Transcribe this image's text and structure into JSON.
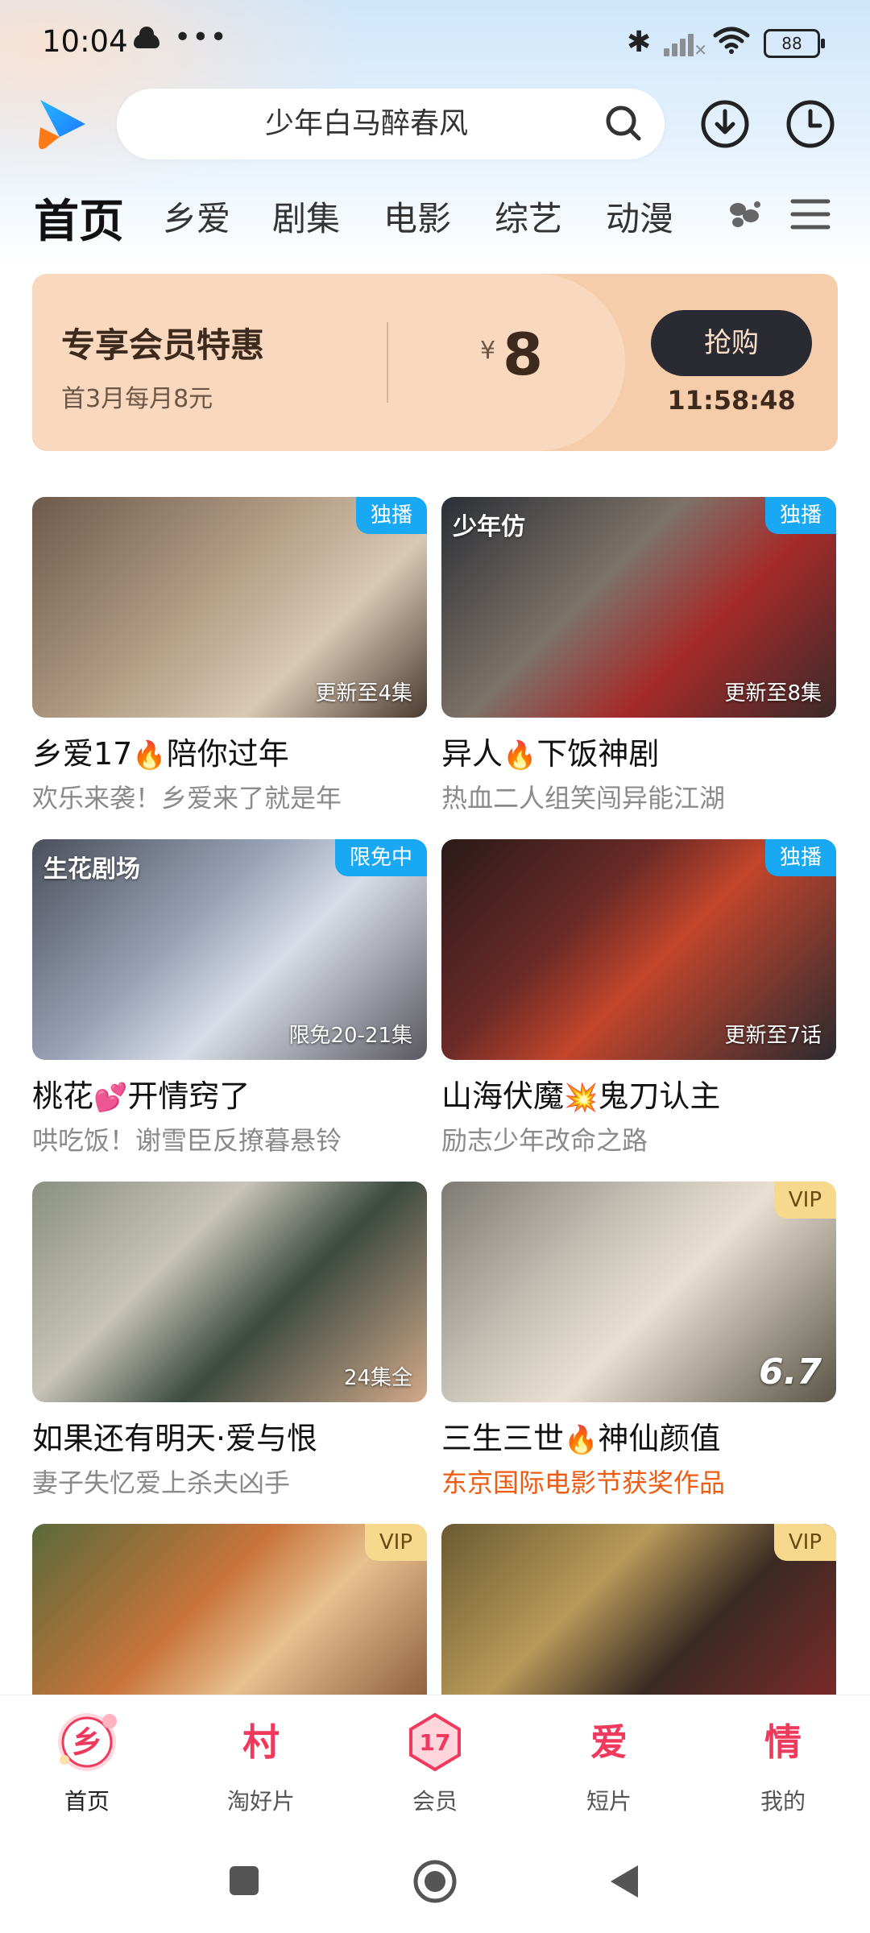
{
  "status_bar": {
    "time": "10:04",
    "dots": "•••",
    "battery": "88"
  },
  "header": {
    "search_query": "少年白马醉春风",
    "icons": [
      "app-logo-icon",
      "search-icon",
      "download-icon",
      "history-clock-icon"
    ]
  },
  "tabs": [
    "首页",
    "乡爱",
    "剧集",
    "电影",
    "综艺",
    "动漫"
  ],
  "promo": {
    "title": "专享会员特惠",
    "subtitle": "首3月每月8元",
    "currency": "¥",
    "price": "8",
    "button": "抢购",
    "countdown": "11:58:48"
  },
  "cards": [
    {
      "title_a": "乡爱17",
      "emoji": "🔥",
      "title_b": "陪你过年",
      "subtitle": "欢乐来袭！乡爱来了就是年",
      "badge": "独播",
      "episode": "更新至4集"
    },
    {
      "title_a": "异人",
      "emoji": "🔥",
      "title_b": "下饭神剧",
      "subtitle": "热血二人组笑闯异能江湖",
      "badge": "独播",
      "episode": "更新至8集",
      "logo": "少年仿"
    },
    {
      "title_a": "桃花",
      "emoji": "💕",
      "title_b": "开情窍了",
      "subtitle": "哄吃饭！谢雪臣反撩暮悬铃",
      "badge": "限免中",
      "episode": "限免20-21集",
      "logo": "生花剧场"
    },
    {
      "title_a": "山海伏魔",
      "emoji": "💥",
      "title_b": "鬼刀认主",
      "subtitle": "励志少年改命之路",
      "badge": "独播",
      "episode": "更新至7话"
    },
    {
      "title_a": "如果还有明天·爱与恨",
      "emoji": "",
      "title_b": "",
      "subtitle": "妻子失忆爱上杀夫凶手",
      "badge": "",
      "episode": "24集全"
    },
    {
      "title_a": "三生三世",
      "emoji": "🔥",
      "title_b": "神仙颜值",
      "subtitle": "东京国际电影节获奖作品",
      "badge": "VIP",
      "rating": "6.7"
    },
    {
      "badge": "VIP"
    },
    {
      "badge": "VIP"
    }
  ],
  "bottom_nav": [
    {
      "label": "首页",
      "glyph": "乡"
    },
    {
      "label": "淘好片",
      "glyph": "村"
    },
    {
      "label": "会员",
      "glyph": "17"
    },
    {
      "label": "短片",
      "glyph": "爱"
    },
    {
      "label": "我的",
      "glyph": "情"
    }
  ],
  "colors": {
    "accent_blue": "#19a8f3",
    "promo_bg": "#f8d9bf",
    "buy_button": "#2a2a33",
    "nav_red": "#ef3a5d",
    "subtitle_orange": "#ee5b12"
  }
}
